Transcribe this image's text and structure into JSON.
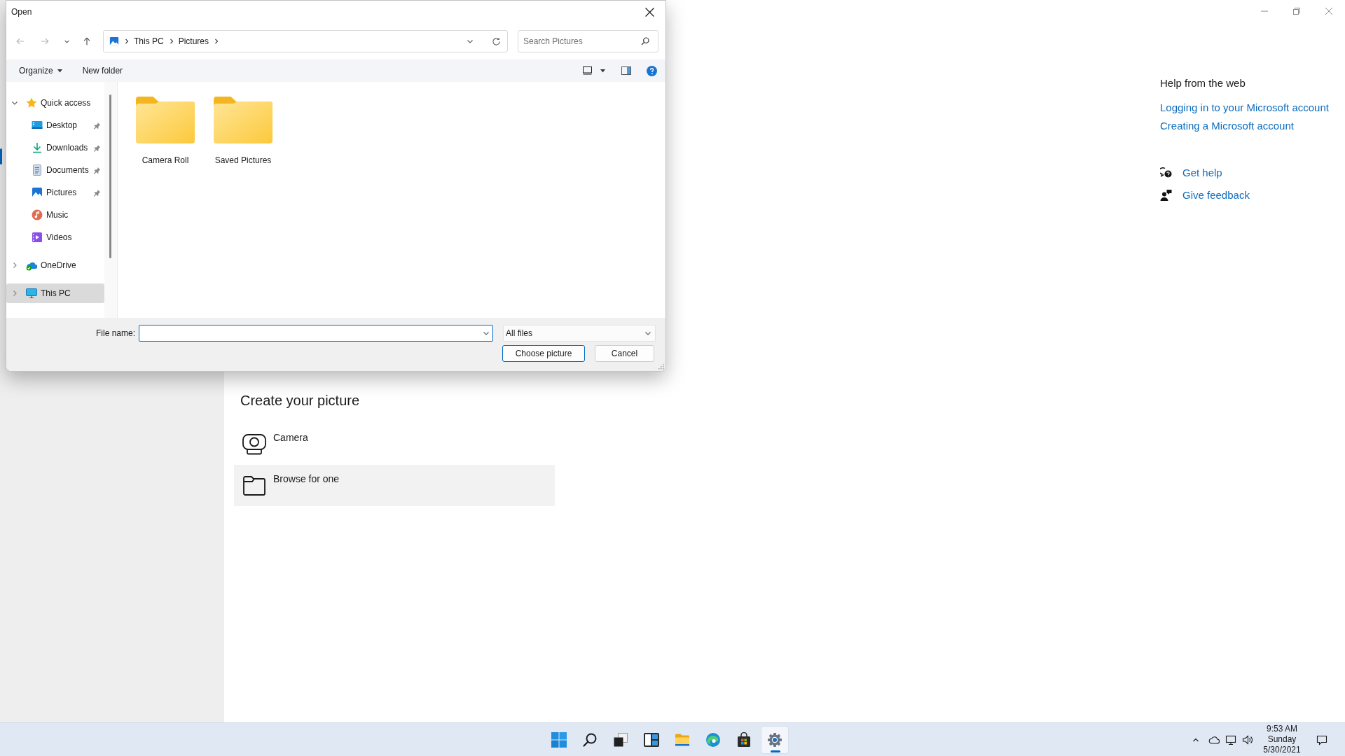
{
  "settings": {
    "create_picture": {
      "heading": "Create your picture",
      "options": [
        {
          "kind": "camera",
          "label": "Camera",
          "highlighted": false
        },
        {
          "kind": "browse",
          "label": "Browse for one",
          "highlighted": true
        }
      ]
    },
    "help": {
      "heading": "Help from the web",
      "links": [
        "Logging in to your Microsoft account",
        "Creating a Microsoft account"
      ],
      "actions": [
        {
          "kind": "help",
          "label": "Get help"
        },
        {
          "kind": "feedback",
          "label": "Give feedback"
        }
      ]
    }
  },
  "dialog": {
    "title": "Open",
    "nav_buttons": [
      {
        "kind": "back",
        "disabled": true
      },
      {
        "kind": "forward",
        "disabled": true
      },
      {
        "kind": "recent",
        "disabled": false
      },
      {
        "kind": "up",
        "disabled": false
      }
    ],
    "breadcrumb": [
      "This PC",
      "Pictures"
    ],
    "search": {
      "placeholder": "Search Pictures"
    },
    "toolbar": [
      {
        "label": "Organize",
        "menu": true
      },
      {
        "label": "New folder",
        "menu": false
      }
    ],
    "nav_tree": [
      {
        "kind": "star",
        "label": "Quick access",
        "expanded": true,
        "selected": false,
        "children": [
          {
            "kind": "desktop",
            "label": "Desktop",
            "pinned": true,
            "selected": false
          },
          {
            "kind": "downloads",
            "label": "Downloads",
            "pinned": true,
            "selected": false
          },
          {
            "kind": "documents",
            "label": "Documents",
            "pinned": true,
            "selected": false
          },
          {
            "kind": "pictures",
            "label": "Pictures",
            "pinned": true,
            "selected": false
          },
          {
            "kind": "music",
            "label": "Music",
            "pinned": false,
            "selected": false
          },
          {
            "kind": "videos",
            "label": "Videos",
            "pinned": false,
            "selected": false
          }
        ]
      },
      {
        "kind": "onedrive",
        "label": "OneDrive",
        "expanded": false,
        "selected": false
      },
      {
        "kind": "pc",
        "label": "This PC",
        "expanded": false,
        "selected": true
      }
    ],
    "folders": [
      "Camera Roll",
      "Saved Pictures"
    ],
    "file_name": {
      "label": "File name:",
      "focused": true
    },
    "file_type": {
      "value": "All files"
    },
    "buttons": [
      {
        "label": "Choose picture",
        "default": true
      },
      {
        "label": "Cancel",
        "default": false
      }
    ]
  },
  "taskbar": {
    "apps": [
      {
        "kind": "start",
        "active": false
      },
      {
        "kind": "search",
        "active": false
      },
      {
        "kind": "task_view",
        "active": false
      },
      {
        "kind": "widgets",
        "active": false
      },
      {
        "kind": "explorer",
        "active": false
      },
      {
        "kind": "edge",
        "active": false
      },
      {
        "kind": "store",
        "active": false
      },
      {
        "kind": "settings",
        "active": true
      }
    ],
    "clock": {
      "time": "9:53 AM",
      "day": "Sunday",
      "date": "5/30/2021"
    }
  }
}
